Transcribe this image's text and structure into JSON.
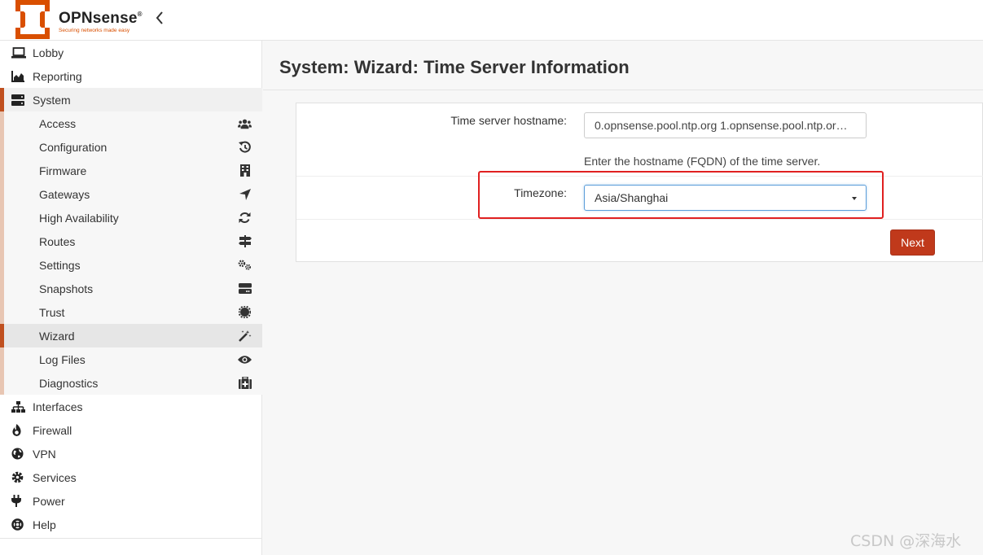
{
  "header": {
    "brand": "OPNsense",
    "trademark": "®",
    "tagline": "Securing networks made easy",
    "collapse_icon": "chevron-left-icon",
    "accent_color": "#d94f00"
  },
  "sidebar": {
    "top_items": [
      {
        "label": "Lobby",
        "icon": "laptop-icon"
      },
      {
        "label": "Reporting",
        "icon": "area-chart-icon"
      },
      {
        "label": "System",
        "icon": "server-icon"
      }
    ],
    "system_items": [
      {
        "label": "Access",
        "icon": "users-icon"
      },
      {
        "label": "Configuration",
        "icon": "history-icon"
      },
      {
        "label": "Firmware",
        "icon": "building-icon"
      },
      {
        "label": "Gateways",
        "icon": "location-arrow-icon"
      },
      {
        "label": "High Availability",
        "icon": "refresh-icon"
      },
      {
        "label": "Routes",
        "icon": "map-signs-icon"
      },
      {
        "label": "Settings",
        "icon": "cogs-icon"
      },
      {
        "label": "Snapshots",
        "icon": "hdd-icon"
      },
      {
        "label": "Trust",
        "icon": "certificate-icon"
      },
      {
        "label": "Wizard",
        "icon": "magic-wand-icon"
      },
      {
        "label": "Log Files",
        "icon": "eye-icon"
      },
      {
        "label": "Diagnostics",
        "icon": "medkit-icon"
      }
    ],
    "bottom_items": [
      {
        "label": "Interfaces",
        "icon": "sitemap-icon"
      },
      {
        "label": "Firewall",
        "icon": "fire-icon"
      },
      {
        "label": "VPN",
        "icon": "globe-icon"
      },
      {
        "label": "Services",
        "icon": "cog-icon"
      },
      {
        "label": "Power",
        "icon": "plug-icon"
      },
      {
        "label": "Help",
        "icon": "life-ring-icon"
      }
    ],
    "current": "Wizard"
  },
  "main": {
    "title": "System: Wizard: Time Server Information",
    "time_server": {
      "label": "Time server hostname:",
      "value": "0.opnsense.pool.ntp.org 1.opnsense.pool.ntp.or…",
      "help": "Enter the hostname (FQDN) of the time server."
    },
    "timezone": {
      "label": "Timezone:",
      "selected": "Asia/Shanghai"
    },
    "next_button": "Next",
    "highlight_color": "#e02020",
    "button_color": "#c0391b"
  },
  "watermark": "CSDN @深海水"
}
